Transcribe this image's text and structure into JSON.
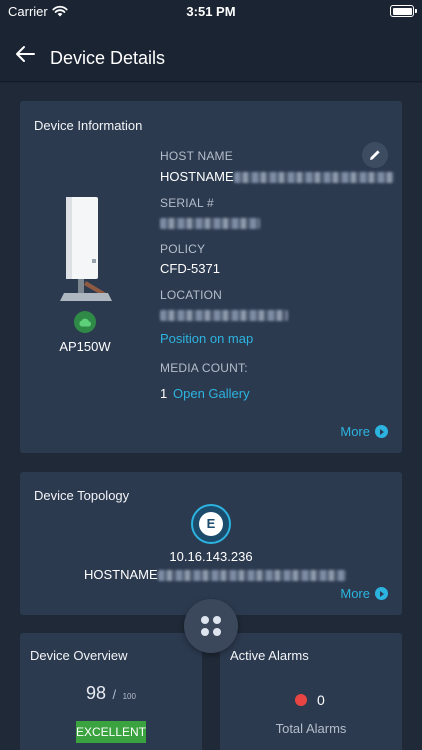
{
  "status_bar": {
    "carrier": "Carrier",
    "time": "3:51 PM"
  },
  "header": {
    "title": "Device Details"
  },
  "device_info": {
    "title": "Device Information",
    "model": "AP150W",
    "host_name_label": "HOST NAME",
    "host_name_value": "HOSTNAME",
    "serial_label": "SERIAL #",
    "policy_label": "POLICY",
    "policy_value": "CFD-5371",
    "location_label": "LOCATION",
    "position_link": "Position on map",
    "media_count_label": "MEDIA COUNT:",
    "media_count_value": "1",
    "open_gallery_link": "Open Gallery",
    "more_label": "More",
    "status_color": "#2f8a47"
  },
  "topology": {
    "title": "Device Topology",
    "ip": "10.16.143.236",
    "hostname": "HOSTNAME",
    "icon_letter": "E",
    "more_label": "More"
  },
  "overview": {
    "title": "Device Overview",
    "score": "98",
    "separator": "/",
    "score_max": "100",
    "badge": "EXCELLENT",
    "badge_color": "#3aa23e"
  },
  "alarms": {
    "title": "Active Alarms",
    "count": "0",
    "label": "Total Alarms",
    "dot_color": "#e84542"
  },
  "accent_color": "#2cb4e0"
}
